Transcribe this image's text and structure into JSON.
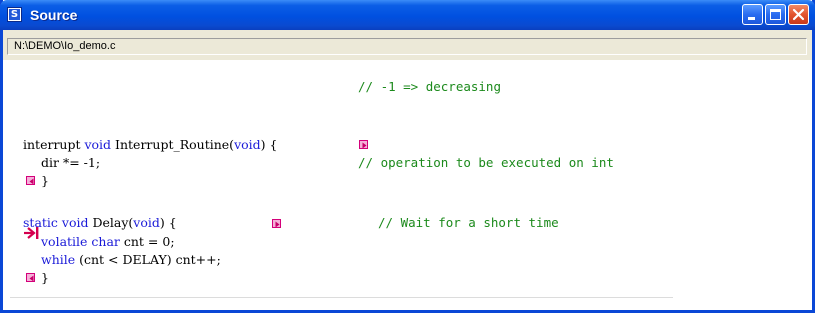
{
  "window": {
    "title": "Source",
    "app_icon_letter": "S"
  },
  "path_bar": {
    "file_path": "N:\\DEMO\\Io_demo.c"
  },
  "code": {
    "line1": {
      "comment": "// -1 => decreasing"
    },
    "line2": {
      "t1": "interrupt ",
      "k1": "void",
      "t2": " Interrupt_Routine(",
      "k2": "void",
      "t3": ") {"
    },
    "line3": {
      "code": "dir *= -1;",
      "comment": "// operation to be executed on int"
    },
    "line4": {
      "code": "}"
    },
    "line5": {
      "k1": "static void",
      "t1": " Delay(",
      "k2": "void",
      "t2": ") {",
      "comment": "// Wait for a short time"
    },
    "line6": {
      "k1": "volatile char",
      "t1": " cnt = 0;"
    },
    "line7": {
      "k1": "while",
      "t1": " (cnt < DELAY) cnt++;"
    },
    "line8": {
      "code": "}"
    }
  },
  "colors": {
    "keyword": "#1a1ad8",
    "comment": "#1c8a1c",
    "titlebar": "#0050e0",
    "breakpoint": "#d4004e"
  },
  "icons": {
    "app": "source-app-icon",
    "minimize": "minimize-icon",
    "maximize": "maximize-icon",
    "close": "close-icon",
    "breakpoint": "breakpoint-arrow-icon",
    "fold_collapse": "fold-collapse-icon",
    "fold_expand": "fold-expand-icon"
  }
}
